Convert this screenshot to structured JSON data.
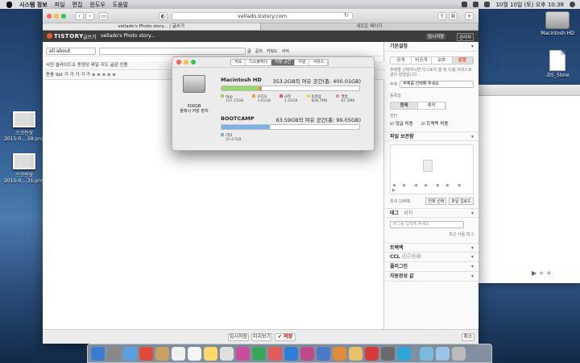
{
  "menubar": {
    "app": "시스템 정보",
    "items": [
      "파일",
      "편집",
      "윈도우",
      "도움말"
    ],
    "clock": "10월 10일 (토) 오후 10:38"
  },
  "desktop": {
    "icons": [
      {
        "label": "Macintosh HD"
      },
      {
        "label": ".DS_Store"
      },
      {
        "label": "스크린샷\n2015-0....58.png"
      },
      {
        "label": "스크린샷\n2015-0....31.png"
      }
    ]
  },
  "browser": {
    "url": "vellado.tistory.com",
    "tabs": [
      "vellado's Photo story... | 글쓰기",
      "새로운 페이지"
    ],
    "logo": "TISTORY",
    "header_menu": "글쓰기",
    "blog_name": "vellado's Photo story...",
    "header_right": "임시저장",
    "header_btn": "관리자",
    "editor": {
      "category": "all about",
      "toolbar1": "사진  슬라이드쇼  동영상  파일  지도  글감  인용",
      "toolbar2": "돋움  9pt  가  가  가  가  가  ≡  ≡  ≡  ≡  ≡",
      "radio_labels": [
        "글",
        "공지",
        "키워드",
        "서식"
      ]
    },
    "side": {
      "title": "기본설정",
      "tabs": [
        "공개",
        "비공개",
        "보호",
        "발행"
      ],
      "visibility_note": "주제별 선택하시면 티스토리 홈 및 다음 서비스로 글이 발행됩니다",
      "topic_label": "주제",
      "topic_value": "주제를 선택해 주세요",
      "permission_label": "동록일",
      "time_tabs": [
        "현재",
        "예약"
      ],
      "comment_label": "권한",
      "perm1": "댓글 허용",
      "perm2": "트랙백 허용",
      "file_title": "파일 보관함",
      "file_label": "파일 첨부",
      "file_note": "최대 10MB",
      "upload_btn": "전체 선택",
      "attach_btn": "파일 업로드",
      "tag_title": "태그",
      "tag_sub": "위치",
      "tag_placeholder": "태그를 입력해 주세요",
      "tag_hint": "최근 사용 태그",
      "sec_trackback": "트랙백",
      "sec_ccl": "CCL",
      "sec_ogp": "플러그인",
      "sec_location": "자동완성 값"
    },
    "footer": {
      "btn1": "임시저장",
      "btn2": "미리보기",
      "btn3": "저장",
      "btn4": "취소"
    }
  },
  "about": {
    "tabs": [
      "개요",
      "디스플레이",
      "저장 공간",
      "지원",
      "서비스"
    ],
    "active_tab": "저장 공간",
    "disk_caption": "500GB\n플래시 저장 장치",
    "disk1": {
      "name": "Macintosh HD",
      "free": "353.2GB의 여유 공간(총: 400.01GB)",
      "usage": {
        "app": 0.27,
        "docs": 0.01,
        "photos": 0.005,
        "movies": 0.002,
        "other": 0.005
      },
      "legend": [
        {
          "label": "App",
          "value": "107.15GB",
          "color": "#97d66f"
        },
        {
          "label": "오디오",
          "value": "3.61GB",
          "color": "#f4a13a"
        },
        {
          "label": "사진",
          "value": "1.42GB",
          "color": "#ef5b6b"
        },
        {
          "label": "동영상",
          "value": "838.7MB",
          "color": "#f6d34a"
        },
        {
          "label": "백업",
          "value": "81.5MB",
          "color": "#e88ad1"
        }
      ]
    },
    "disk2": {
      "name": "BOOTCAMP",
      "free": "63.59GB의 여유 공간(총: 99.05GB)",
      "usage": {
        "other": 0.35
      },
      "legend": [
        {
          "label": "기타",
          "value": "35.47GB",
          "color": "#7ab2ea"
        }
      ]
    }
  },
  "dock_colors": [
    "#3a7cd0",
    "#888",
    "#5aa0e0",
    "#e04a3a",
    "#c8a060",
    "#f0f0f0",
    "#f5f5f5",
    "#ffd86a",
    "#e0e0e0",
    "#cc4b9d",
    "#3aa65a",
    "#e35a5a",
    "#2e7ed6",
    "#c04a8a",
    "#4a7ac8",
    "#e08c3a",
    "#e8c26a",
    "#d83a3a",
    "#6a6a6a",
    "#2aa7d8",
    "#7abadb",
    "#9ac4e8",
    "#bbb"
  ]
}
